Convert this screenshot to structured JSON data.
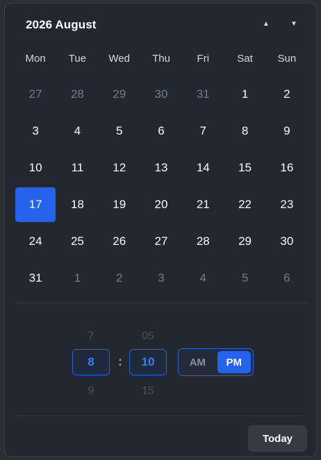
{
  "header": {
    "title": "2026 August",
    "prev_icon": "▲",
    "next_icon": "▼"
  },
  "weekdays": [
    "Mon",
    "Tue",
    "Wed",
    "Thu",
    "Fri",
    "Sat",
    "Sun"
  ],
  "weeks": [
    [
      {
        "d": "27",
        "m": true
      },
      {
        "d": "28",
        "m": true
      },
      {
        "d": "29",
        "m": true
      },
      {
        "d": "30",
        "m": true
      },
      {
        "d": "31",
        "m": true
      },
      {
        "d": "1"
      },
      {
        "d": "2"
      }
    ],
    [
      {
        "d": "3"
      },
      {
        "d": "4"
      },
      {
        "d": "5"
      },
      {
        "d": "6"
      },
      {
        "d": "7"
      },
      {
        "d": "8"
      },
      {
        "d": "9"
      }
    ],
    [
      {
        "d": "10"
      },
      {
        "d": "11"
      },
      {
        "d": "12"
      },
      {
        "d": "13"
      },
      {
        "d": "14"
      },
      {
        "d": "15"
      },
      {
        "d": "16"
      }
    ],
    [
      {
        "d": "17",
        "s": true
      },
      {
        "d": "18"
      },
      {
        "d": "19"
      },
      {
        "d": "20"
      },
      {
        "d": "21"
      },
      {
        "d": "22"
      },
      {
        "d": "23"
      }
    ],
    [
      {
        "d": "24"
      },
      {
        "d": "25"
      },
      {
        "d": "26"
      },
      {
        "d": "27"
      },
      {
        "d": "28"
      },
      {
        "d": "29"
      },
      {
        "d": "30"
      }
    ],
    [
      {
        "d": "31"
      },
      {
        "d": "1",
        "m": true
      },
      {
        "d": "2",
        "m": true
      },
      {
        "d": "3",
        "m": true
      },
      {
        "d": "4",
        "m": true
      },
      {
        "d": "5",
        "m": true
      },
      {
        "d": "6",
        "m": true
      }
    ]
  ],
  "time": {
    "hour_prev": "7",
    "hour": "8",
    "hour_next": "9",
    "separator": ":",
    "minute_prev": "05",
    "minute": "10",
    "minute_next": "15",
    "am_label": "AM",
    "pm_label": "PM",
    "selected_period": "PM"
  },
  "footer": {
    "today_label": "Today"
  },
  "colors": {
    "accent": "#2563eb",
    "background": "#232830",
    "muted_text": "#6f7e91"
  }
}
